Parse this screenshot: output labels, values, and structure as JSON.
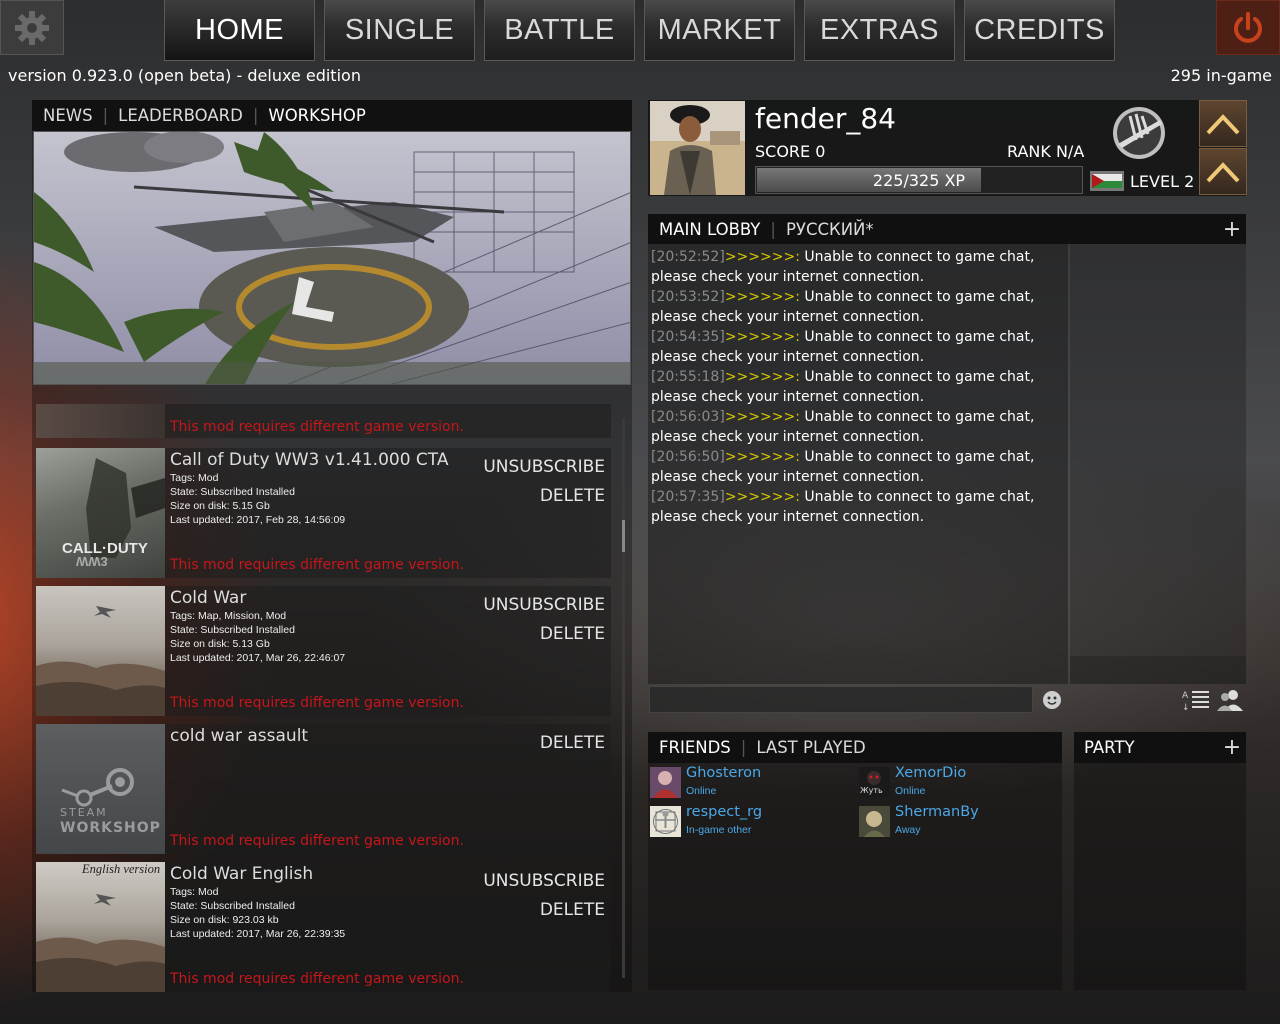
{
  "nav": {
    "tabs": [
      "HOME",
      "SINGLE",
      "BATTLE",
      "MARKET",
      "EXTRAS",
      "CREDITS"
    ],
    "active": "HOME",
    "settings_icon": "gear-icon",
    "power_icon": "power-icon",
    "accent_power": "#d4431c"
  },
  "status": {
    "version": "version 0.923.0 (open beta) - deluxe edition",
    "in_game": "295 in-game"
  },
  "left_tabs": {
    "news": "NEWS",
    "leaderboard": "LEADERBOARD",
    "workshop": "WORKSHOP",
    "active": "WORKSHOP"
  },
  "mods": {
    "warning": "This mod requires different game version.",
    "unsubscribe_label": "UNSUBSCRIBE",
    "delete_label": "DELETE",
    "items": [
      {
        "title": "Call of Duty WW3 v1.41.000 CTA",
        "tags": "Tags:  Mod",
        "state": "State:  Subscribed Installed",
        "size": "Size on disk:  5.15 Gb",
        "updated": "Last updated:  2017, Feb 28, 14:56:09",
        "thumb_text": "CALL·DUTY",
        "thumb_sub": "WW3"
      },
      {
        "title": "Cold War",
        "tags": "Tags:  Map, Mission, Mod",
        "state": "State:  Subscribed Installed",
        "size": "Size on disk:  5.13 Gb",
        "updated": "Last updated:  2017, Mar 26, 22:46:07"
      },
      {
        "title": "cold war assault",
        "thumb_text": "STEAM",
        "thumb_sub": "WORKSHOP"
      },
      {
        "title": "Cold War English",
        "tags": "Tags:  Mod",
        "state": "State:  Subscribed Installed",
        "size": "Size on disk:  923.03 kb",
        "updated": "Last updated:  2017, Mar 26, 22:39:35",
        "thumb_text": "English version"
      }
    ]
  },
  "profile": {
    "username": "fender_84",
    "score": "SCORE 0",
    "rank": "RANK N/A",
    "xp": "225/325 XP",
    "xp_fraction": 0.6923,
    "level": "LEVEL 2",
    "emblem_icon": "rank-emblem-icon",
    "flag_icon": "flag-icon"
  },
  "chat": {
    "tab_main": "MAIN LOBBY",
    "tab_lang": "РУССКИЙ*",
    "plus": "+",
    "arrows": ">>>>>>:",
    "message": "Unable to connect to game chat, please check your internet connection.",
    "timestamps": [
      "[20:52:52]",
      "[20:53:52]",
      "[20:54:35]",
      "[20:55:18]",
      "[20:56:03]",
      "[20:56:50]",
      "[20:57:35]"
    ],
    "arrow_color": "#d8c800"
  },
  "friends": {
    "tab_friends": "FRIENDS",
    "tab_last": "LAST PLAYED",
    "status_color": "#4aa8e8",
    "list": [
      {
        "name": "Ghosteron",
        "status": "Online"
      },
      {
        "name": "XemorDio",
        "status": "Online",
        "avatar_text": "Жуть"
      },
      {
        "name": "respect_rg",
        "status": "In-game other"
      },
      {
        "name": "ShermanBy",
        "status": "Away"
      }
    ]
  },
  "party": {
    "title": "PARTY",
    "plus": "+"
  }
}
